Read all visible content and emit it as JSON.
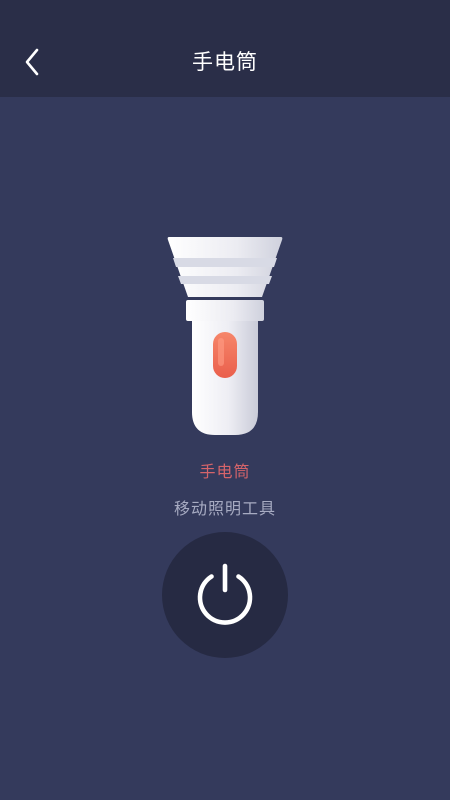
{
  "header": {
    "title": "手电筒",
    "back_icon": "chevron-left-icon"
  },
  "main": {
    "app_name": "手电筒",
    "app_description": "移动照明工具",
    "illustration": "flashlight-icon",
    "power_icon": "power-icon"
  },
  "colors": {
    "background": "#343a5c",
    "header_background": "#2a2e48",
    "accent": "#d5646a",
    "power_button": "#262a43"
  }
}
